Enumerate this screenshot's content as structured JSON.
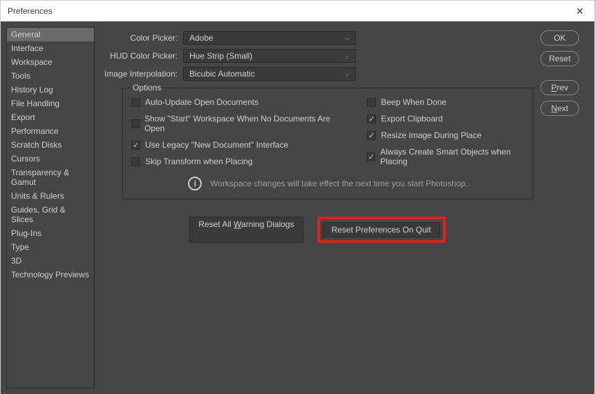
{
  "window": {
    "title": "Preferences"
  },
  "sidebar": {
    "items": [
      "General",
      "Interface",
      "Workspace",
      "Tools",
      "History Log",
      "File Handling",
      "Export",
      "Performance",
      "Scratch Disks",
      "Cursors",
      "Transparency & Gamut",
      "Units & Rulers",
      "Guides, Grid & Slices",
      "Plug-Ins",
      "Type",
      "3D",
      "Technology Previews"
    ],
    "selected": "General"
  },
  "fields": {
    "colorPicker": {
      "label": "Color Picker:",
      "value": "Adobe"
    },
    "hudColorPicker": {
      "label": "HUD Color Picker:",
      "value": "Hue Strip (Small)"
    },
    "imageInterpolation": {
      "label": "Image Interpolation:",
      "value": "Bicubic Automatic"
    }
  },
  "options": {
    "title": "Options",
    "left": [
      {
        "label": "Auto-Update Open Documents",
        "checked": false
      },
      {
        "label": "Show \"Start\" Workspace When No Documents Are Open",
        "checked": false
      },
      {
        "label": "Use Legacy \"New Document\" Interface",
        "checked": true
      },
      {
        "label": "Skip Transform when Placing",
        "checked": false
      }
    ],
    "right": [
      {
        "label": "Beep When Done",
        "checked": false
      },
      {
        "label": "Export Clipboard",
        "checked": true
      },
      {
        "label": "Resize Image During Place",
        "checked": true
      },
      {
        "label": "Always Create Smart Objects when Placing",
        "checked": true
      }
    ],
    "info": "Workspace changes will take effect the next time you start Photoshop."
  },
  "bottomButtons": {
    "resetWarnings_pre": "Reset All ",
    "resetWarnings_u": "W",
    "resetWarnings_post": "arning Dialogs",
    "resetOnQuit": "Reset Preferences On Quit"
  },
  "rightButtons": {
    "ok": "OK",
    "reset": "Reset",
    "prev_u": "P",
    "prev_post": "rev",
    "next_u": "N",
    "next_post": "ext"
  }
}
